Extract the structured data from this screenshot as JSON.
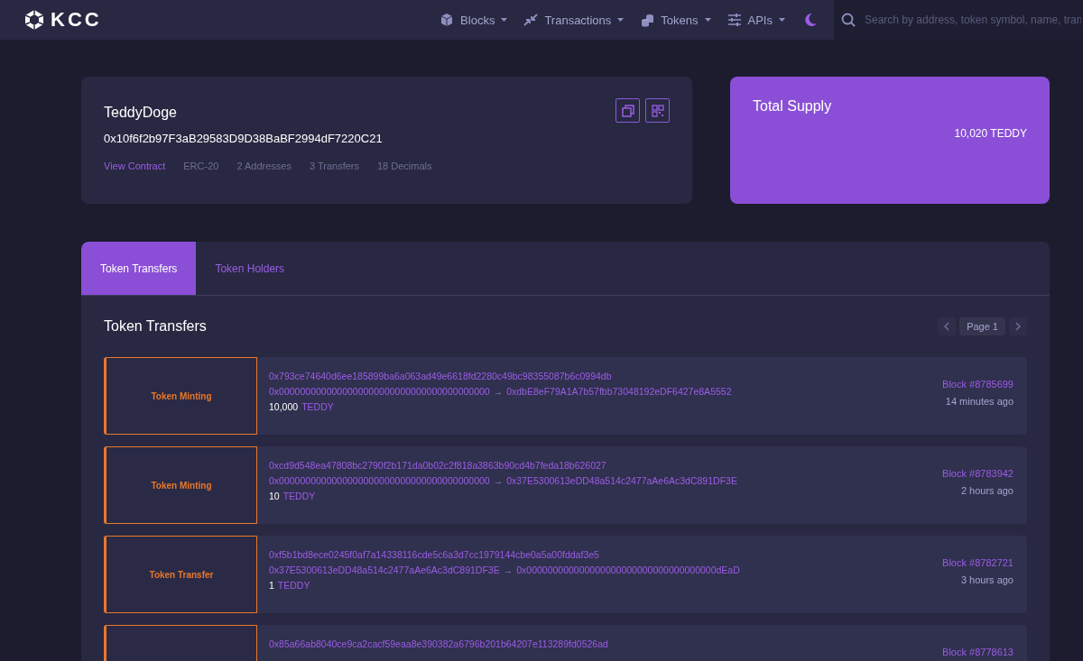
{
  "header": {
    "logo": "KCC",
    "nav": [
      {
        "label": "Blocks"
      },
      {
        "label": "Transactions"
      },
      {
        "label": "Tokens"
      },
      {
        "label": "APIs"
      }
    ],
    "search": {
      "placeholder": "Search by address, token symbol, name, tran"
    }
  },
  "token": {
    "name": "TeddyDoge",
    "address": "0x10f6f2b97F3aB29583D9D38BaBF2994dF7220C21",
    "link": "View Contract",
    "facts": [
      "ERC-20",
      "2 Addresses",
      "3 Transfers",
      "18 Decimals"
    ]
  },
  "supply": {
    "title": "Total Supply",
    "value": "10,020 TEDDY"
  },
  "tabs": [
    {
      "label": "Token Transfers",
      "selected": true
    },
    {
      "label": "Token Holders",
      "selected": false
    }
  ],
  "transfers": {
    "title": "Token Transfers",
    "page": "Page 1",
    "rows": [
      {
        "type": "Token Minting",
        "hash": "0x793ce74640d6ee185899ba6a063ad49e6618fd2280c49bc98355087b6c0994db",
        "from": "0x0000000000000000000000000000000000000000",
        "arrow": "→",
        "to": "0xdbE8eF79A1A7b57fbb73048192eDF6427e8A5552",
        "amount": "10,000",
        "symbol": "TEDDY",
        "block": "Block #8785699",
        "age": "14 minutes ago"
      },
      {
        "type": "Token Minting",
        "hash": "0xcd9d548ea47808bc2790f2b171da0b02c2f818a3863b90cd4b7feda18b626027",
        "from": "0x0000000000000000000000000000000000000000",
        "arrow": "→",
        "to": "0x37E5300613eDD48a514c2477aAe6Ac3dC891DF3E",
        "amount": "10",
        "symbol": "TEDDY",
        "block": "Block #8783942",
        "age": "2 hours ago"
      },
      {
        "type": "Token Transfer",
        "hash": "0xf5b1bd8ece0245f0af7a14338116cde5c6a3d7cc1979144cbe0a5a00fddaf3e5",
        "from": "0x37E5300613eDD48a514c2477aAe6Ac3dC891DF3E",
        "arrow": "→",
        "to": "0x000000000000000000000000000000000000dEaD",
        "amount": "1",
        "symbol": "TEDDY",
        "block": "Block #8782721",
        "age": "3 hours ago"
      },
      {
        "hash": "0x85a66ab8040ce9ca2cacf59eaa8e390382a6796b201b64207e113289fd0526ad",
        "block": "Block #8778613"
      }
    ]
  }
}
